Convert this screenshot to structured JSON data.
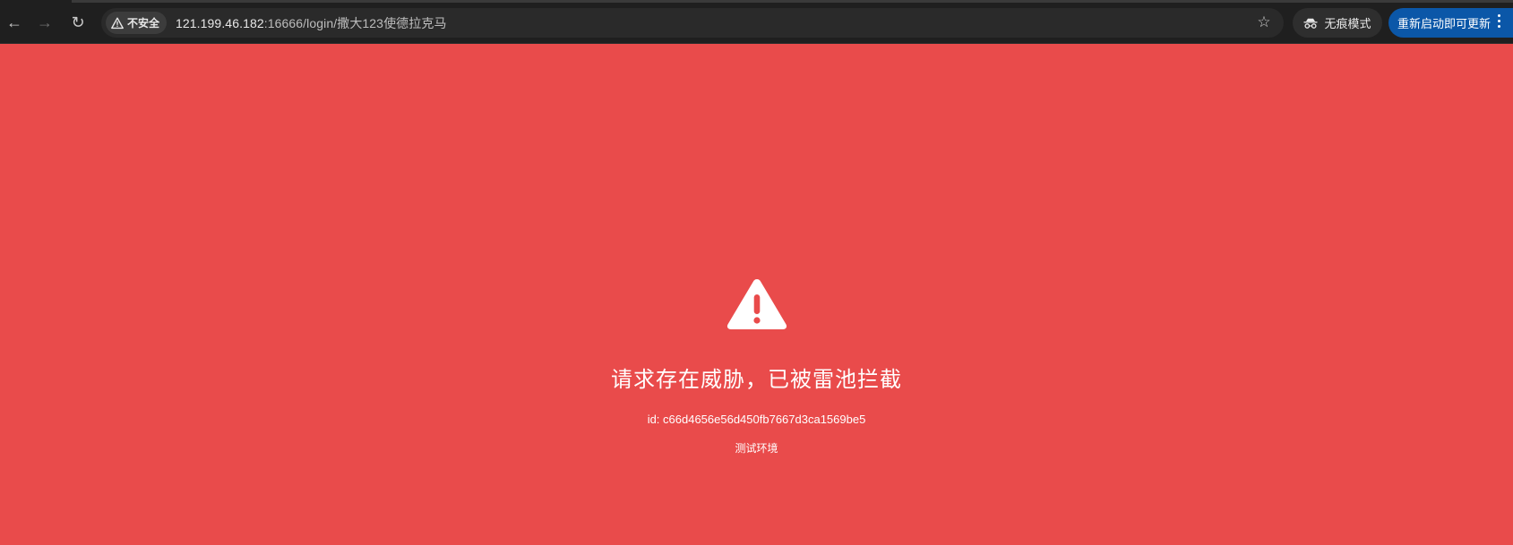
{
  "browser": {
    "security_label": "不安全",
    "url_host": "121.199.46.182",
    "url_path": ":16666/login/撒大123使德拉克马",
    "incognito_label": "无痕模式",
    "update_label": "重新启动即可更新",
    "icons": {
      "back": "back-arrow-icon",
      "forward": "forward-arrow-icon",
      "reload": "reload-icon",
      "security": "warning-triangle-icon",
      "bookmark": "star-icon",
      "incognito": "incognito-icon",
      "menu": "kebab-menu-icon"
    }
  },
  "block_page": {
    "headline": "请求存在威胁，已被雷池拦截",
    "request_id": "id: c66d4656e56d450fb7667d3ca1569be5",
    "environment": "测试环境",
    "icon": "warning-triangle-icon",
    "background_color": "#e94b4b"
  }
}
